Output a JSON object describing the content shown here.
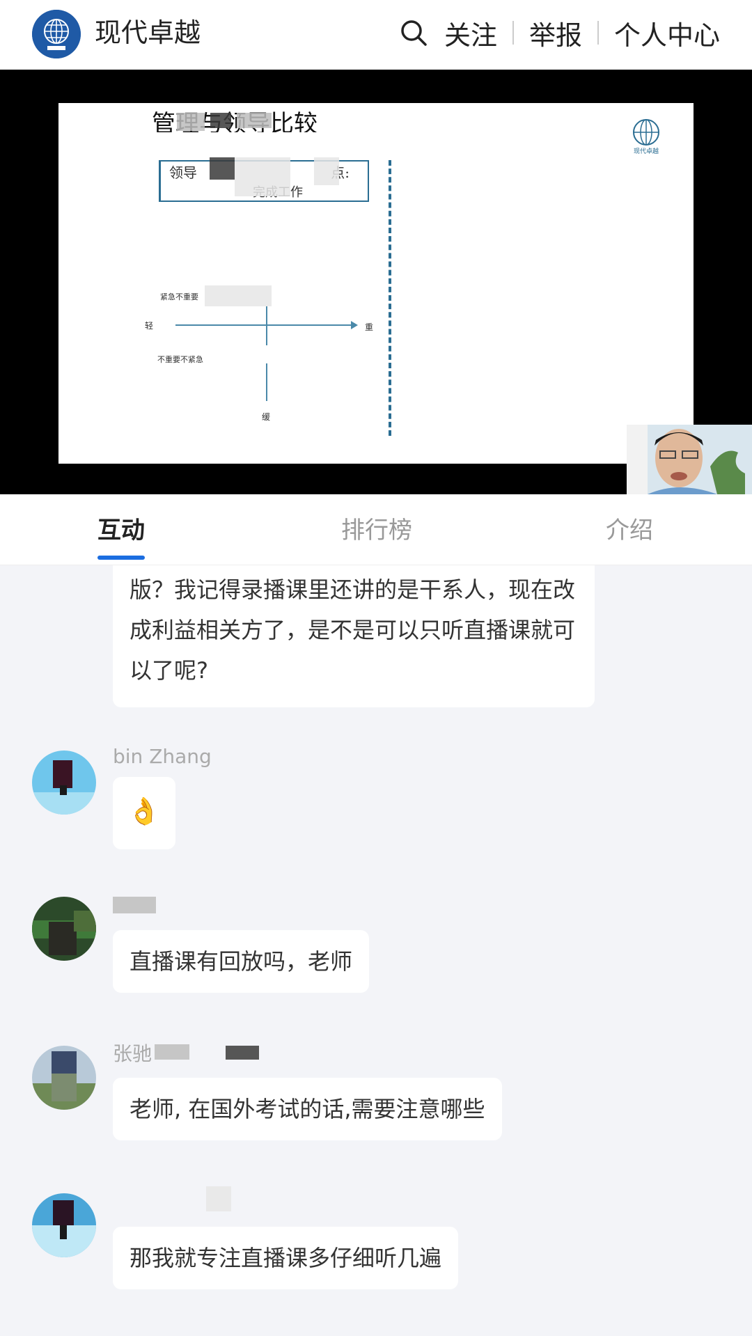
{
  "header": {
    "brand": "现代卓越",
    "follow": "关注",
    "report": "举报",
    "profile": "个人中心"
  },
  "slide": {
    "title": "管理与领导比较",
    "box_left": "领导",
    "box_right": "点:",
    "box_sub": "完成工作",
    "axis_light": "轻",
    "axis_heavy": "重",
    "axis_slow": "缓",
    "quad_top_left": "紧急不重要",
    "quad_bottom_left": "不重要不紧急",
    "logo_caption": "现代卓越"
  },
  "tabs": {
    "interact": "互动",
    "ranking": "排行榜",
    "intro": "介绍"
  },
  "messages": [
    {
      "username": "",
      "text": "版？我记得录播课里还讲的是干系人，现在改成利益相关方了，是不是可以只听直播课就可以了呢?"
    },
    {
      "username": "bin Zhang",
      "text": "👌"
    },
    {
      "username": "",
      "text": "直播课有回放吗，老师"
    },
    {
      "username": "张驰",
      "text": "老师, 在国外考试的话,需要注意哪些"
    },
    {
      "username": "",
      "text": "那我就专注直播课多仔细听几遍"
    }
  ],
  "colors": {
    "accent": "#1b6de0",
    "brand_blue": "#1f5aa6",
    "slide_line": "#2a6d92"
  }
}
